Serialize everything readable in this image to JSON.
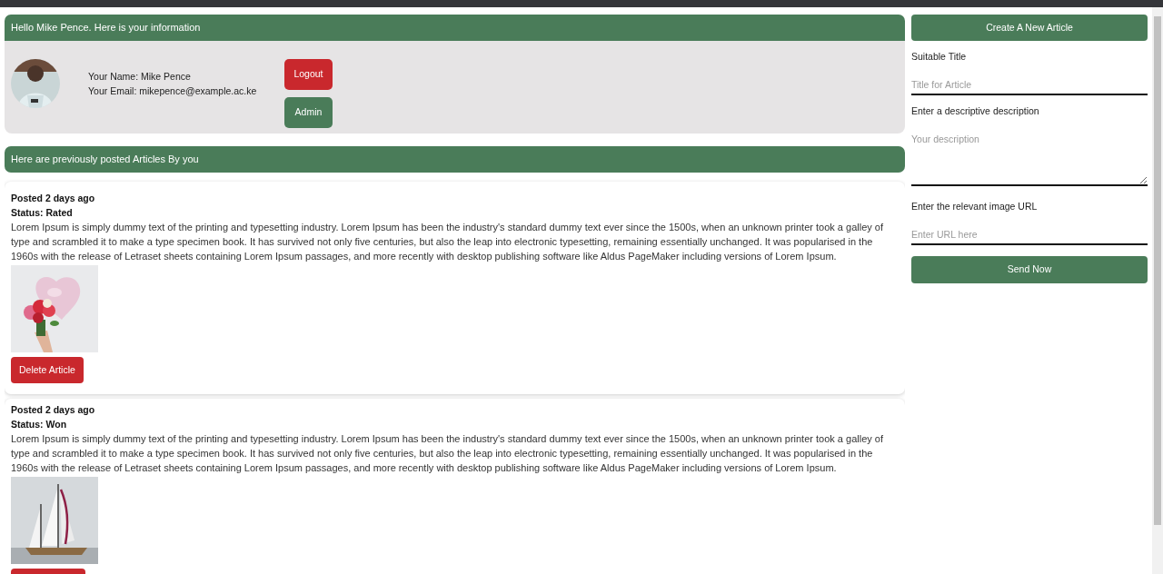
{
  "profile": {
    "greeting": "Hello Mike Pence. Here is your information",
    "name_line": "Your Name: Mike Pence",
    "email_line": "Your Email: mikepence@example.ac.ke",
    "buttons": [
      {
        "label": "Logout",
        "kind": "danger"
      },
      {
        "label": "Admin",
        "kind": "success"
      }
    ]
  },
  "articles_heading": "Here are previously posted Articles By you",
  "articles": [
    {
      "posted": "Posted 2 days ago",
      "status": "Status: Rated",
      "body": "Lorem Ipsum is simply dummy text of the printing and typesetting industry. Lorem Ipsum has been the industry's standard dummy text ever since the 1500s, when an unknown printer took a galley of type and scrambled it to make a type specimen book. It has survived not only five centuries, but also the leap into electronic typesetting, remaining essentially unchanged. It was popularised in the 1960s with the release of Letraset sheets containing Lorem Ipsum passages, and more recently with desktop publishing software like Aldus PageMaker including versions of Lorem Ipsum.",
      "delete_label": "Delete Article"
    },
    {
      "posted": "Posted 2 days ago",
      "status": "Status: Won",
      "body": "Lorem Ipsum is simply dummy text of the printing and typesetting industry. Lorem Ipsum has been the industry's standard dummy text ever since the 1500s, when an unknown printer took a galley of type and scrambled it to make a type specimen book. It has survived not only five centuries, but also the leap into electronic typesetting, remaining essentially unchanged. It was popularised in the 1960s with the release of Letraset sheets containing Lorem Ipsum passages, and more recently with desktop publishing software like Aldus PageMaker including versions of Lorem Ipsum."
    }
  ],
  "form": {
    "title": "Create A New Article",
    "fields": [
      {
        "label": "Suitable Title",
        "placeholder": "Title for Article",
        "kind": "input"
      },
      {
        "label": "Enter a descriptive description",
        "placeholder": "Your description",
        "kind": "textarea"
      },
      {
        "label": "Enter the relevant image URL",
        "placeholder": "Enter URL here",
        "kind": "input"
      }
    ],
    "submit": "Send Now"
  }
}
